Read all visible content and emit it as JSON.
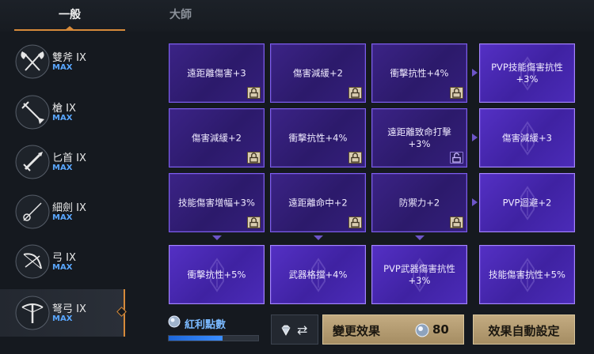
{
  "tabs": [
    {
      "label": "一般",
      "active": true
    },
    {
      "label": "大師",
      "active": false
    }
  ],
  "weapons": [
    {
      "name": "雙斧 IX",
      "level": "MAX",
      "icon": "double-axe-icon",
      "selected": false
    },
    {
      "name": "槍 IX",
      "level": "MAX",
      "icon": "spear-icon",
      "selected": false
    },
    {
      "name": "匕首 IX",
      "level": "MAX",
      "icon": "dagger-icon",
      "selected": false
    },
    {
      "name": "細劍 IX",
      "level": "MAX",
      "icon": "rapier-icon",
      "selected": false
    },
    {
      "name": "弓 IX",
      "level": "MAX",
      "icon": "bow-icon",
      "selected": false
    },
    {
      "name": "弩弓 IX",
      "level": "MAX",
      "icon": "crossbow-icon",
      "selected": true
    }
  ],
  "nodes": [
    [
      {
        "label": "遠距離傷害+3",
        "lock": "locked",
        "style": "normal"
      },
      {
        "label": "傷害減緩+2",
        "lock": "locked",
        "style": "normal"
      },
      {
        "label": "衝擊抗性+4%",
        "lock": "locked",
        "style": "normal"
      },
      {
        "label": "PVP技能傷害抗性\n+3%",
        "lock": "none",
        "style": "bright"
      }
    ],
    [
      {
        "label": "傷害減緩+2",
        "lock": "locked",
        "style": "normal"
      },
      {
        "label": "衝擊抗性+4%",
        "lock": "locked",
        "style": "normal"
      },
      {
        "label": "遠距離致命打擊\n+3%",
        "lock": "unlocked",
        "style": "normal"
      },
      {
        "label": "傷害減緩+3",
        "lock": "none",
        "style": "bright"
      }
    ],
    [
      {
        "label": "技能傷害增幅+3%",
        "lock": "locked",
        "style": "normal"
      },
      {
        "label": "遠距離命中+2",
        "lock": "locked",
        "style": "normal"
      },
      {
        "label": "防禦力+2",
        "lock": "locked",
        "style": "normal"
      },
      {
        "label": "PVP迴避+2",
        "lock": "none",
        "style": "bright"
      }
    ],
    [
      {
        "label": "衝擊抗性+5%",
        "lock": "none",
        "style": "bright"
      },
      {
        "label": "武器格擋+4%",
        "lock": "none",
        "style": "bright"
      },
      {
        "label": "PVP武器傷害抗性\n+3%",
        "lock": "none",
        "style": "bright"
      },
      {
        "label": "技能傷害抗性+5%",
        "lock": "none",
        "style": "bright"
      }
    ]
  ],
  "bonus": {
    "label": "紅利點數",
    "fill": 0.6,
    "icon": "crystal-orb-icon"
  },
  "swap_button": {
    "icon": "diamond-icon",
    "arrows": "⇄"
  },
  "change_effect": {
    "label": "變更效果",
    "cost": "80",
    "icon": "crystal-orb-icon"
  },
  "auto_setting": {
    "label": "效果自動設定"
  },
  "colors": {
    "accent": "#d68a3a",
    "max": "#5aa7ff",
    "node_border": "#7c5cf0",
    "gold_button": "#b89e72"
  }
}
